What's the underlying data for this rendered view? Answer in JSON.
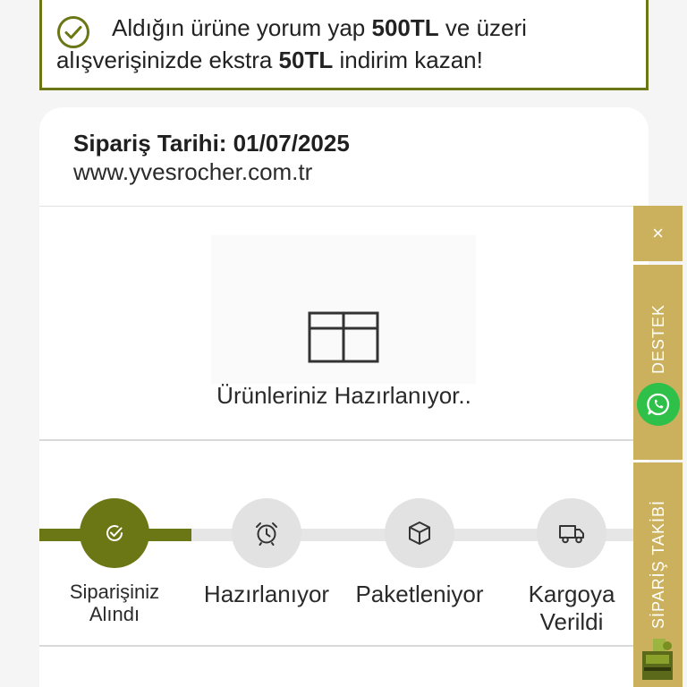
{
  "promo": {
    "part1": "Aldığın ürüne yorum yap ",
    "amount1": "500TL",
    "part2": " ve üzeri alışverişinizde ekstra ",
    "amount2": "50TL",
    "part3": " indirim kazan!"
  },
  "order": {
    "date_label": "Sipariş Tarihi: 01/07/2025",
    "site": "www.yvesrocher.com.tr",
    "status_text": "Ürünleriniz Hazırlanıyor.."
  },
  "steps": [
    {
      "label_line1": "Siparişiniz",
      "label_line2": "Alındı",
      "icon": "check-circle-icon",
      "active": true
    },
    {
      "label": "Hazırlanıyor",
      "icon": "alarm-clock-icon",
      "active": false
    },
    {
      "label": "Paketleniyor",
      "icon": "box-icon",
      "active": false
    },
    {
      "label_line1": "Kargoya",
      "label_line2": "Verildi",
      "icon": "truck-icon",
      "active": false
    }
  ],
  "side": {
    "close": "×",
    "support": "DESTEK",
    "tracking": "SİPARİŞ TAKİBİ"
  },
  "colors": {
    "accent": "#6b7615",
    "side_gold": "#cbb05e",
    "whatsapp": "#2fc04a"
  }
}
